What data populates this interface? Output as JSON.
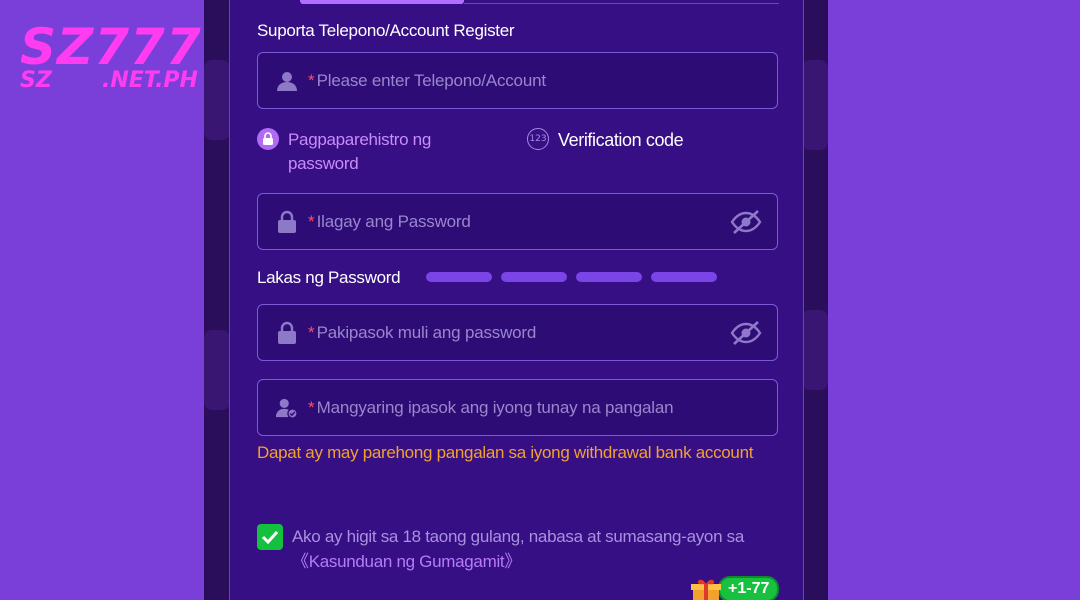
{
  "watermark": {
    "main": "SZ777",
    "sub_left": "SZ",
    "sub_right": ".NET.PH"
  },
  "form": {
    "account_label": "Suporta Telepono/Account Register",
    "account_placeholder": "Please enter Telepono/Account",
    "options": {
      "password_label": "Pagpaparehistro ng password",
      "code_badge": "123",
      "code_label": "Verification code"
    },
    "password_placeholder": "Ilagay ang Password",
    "strength_label": "Lakas ng Password",
    "confirm_placeholder": "Pakipasok muli ang password",
    "realname_placeholder": "Mangyaring ipasok ang iyong tunay na pangalan",
    "realname_warning": "Dapat ay may parehong pangalan sa iyong withdrawal bank account",
    "required_mark": "*",
    "agree_text": "Ako ay higit sa 18 taong gulang, nabasa at sumasang-ayon sa ",
    "agree_link": "《Kasunduan ng Gumagamit》"
  },
  "gift_badge": "+1-77",
  "colors": {
    "background": "#7B3FD9",
    "modal": "#360F85",
    "accent": "#B06BF2",
    "warning": "#F2A12D",
    "check": "#13C13E",
    "watermark": "#FF3CF0"
  },
  "icons": [
    "user-icon",
    "lock-icon",
    "eye-off-icon",
    "user-check-icon",
    "checkmark-icon",
    "gift-icon"
  ]
}
